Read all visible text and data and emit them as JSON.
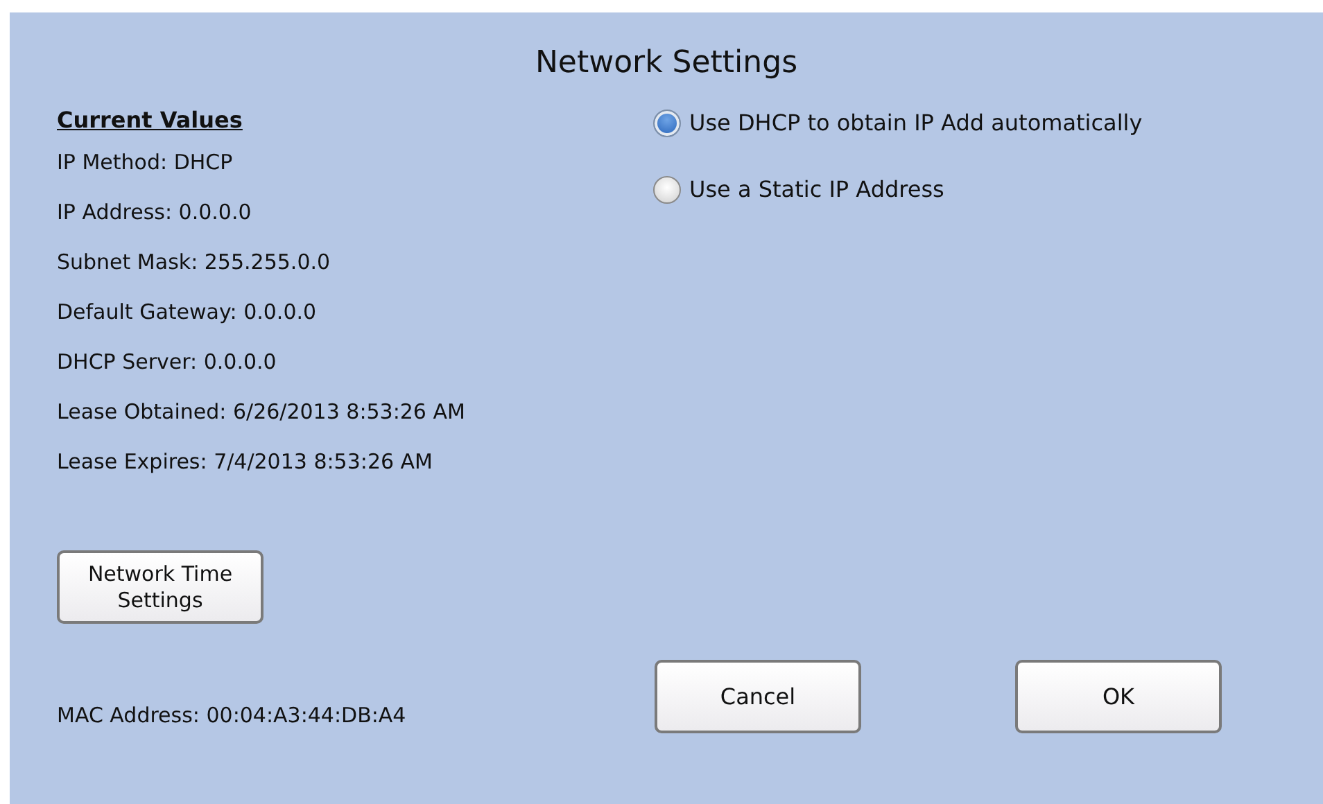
{
  "title": "Network Settings",
  "current_values": {
    "heading": "Current Values",
    "lines": [
      "IP Method: DHCP",
      "IP Address: 0.0.0.0",
      "Subnet Mask: 255.255.0.0",
      "Default Gateway: 0.0.0.0",
      "DHCP Server: 0.0.0.0",
      "Lease Obtained: 6/26/2013 8:53:26 AM",
      "Lease Expires: 7/4/2013 8:53:26 AM"
    ]
  },
  "ip_options": [
    {
      "label": "Use DHCP to obtain IP Add automatically",
      "selected": true
    },
    {
      "label": "Use a Static IP Address",
      "selected": false
    }
  ],
  "time_button": "Network Time Settings",
  "mac_address": "MAC Address: 00:04:A3:44:DB:A4",
  "buttons": [
    "Cancel",
    "OK"
  ]
}
